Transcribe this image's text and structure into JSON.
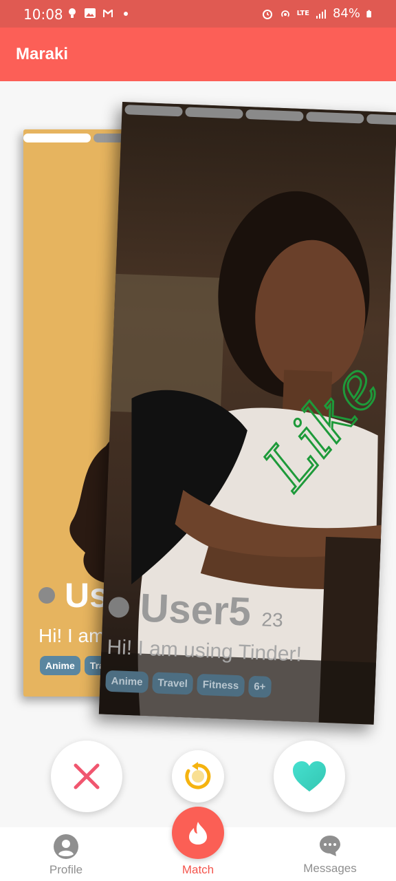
{
  "status_bar": {
    "time": "10:08",
    "network": "LTE",
    "battery": "84%"
  },
  "app_bar": {
    "title": "Maraki"
  },
  "cards": {
    "back": {
      "name": "Us",
      "bio": "Hi! I am",
      "tags": [
        "Anime",
        "Tra"
      ],
      "photo_count": 2,
      "active_photo": 0
    },
    "front": {
      "name": "User5",
      "age": "23",
      "bio": "Hi! I am using Tinder!",
      "tags": [
        "Anime",
        "Travel",
        "Fitness",
        "6+"
      ],
      "stamp": "Like",
      "photo_count": 5
    }
  },
  "actions": {
    "dislike_icon": "close-icon",
    "rewind_icon": "rewind-icon",
    "like_icon": "heart-icon"
  },
  "bottom_nav": {
    "profile": "Profile",
    "match": "Match",
    "messages": "Messages"
  },
  "colors": {
    "primary": "#fc5f57",
    "status_bar": "#e05a52",
    "dislike": "#f0566f",
    "rewind": "#f5b30f",
    "like": "#3fd8c4",
    "like_stamp": "#1e9a3a"
  }
}
